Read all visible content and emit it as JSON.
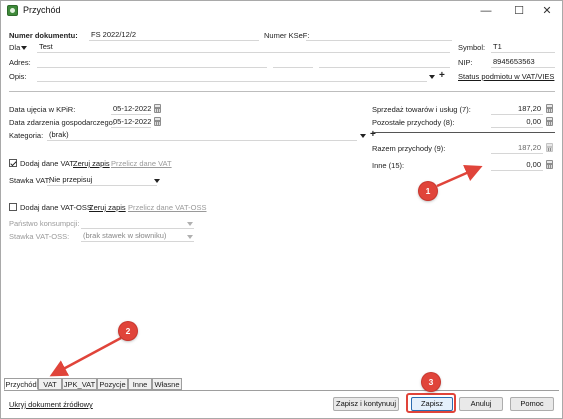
{
  "window": {
    "title": "Przychód",
    "controls": {
      "minimize": "—",
      "maximize": "☐",
      "close": "✕"
    }
  },
  "header": {
    "doc_number_label": "Numer dokumentu:",
    "doc_number_value": "FS 2022/12/2",
    "ksef_label": "Numer KSeF:",
    "ksef_value": "",
    "for_label": "Dla",
    "for_value": "Test",
    "symbol_label": "Symbol:",
    "symbol_value": "T1",
    "address_label": "Adres:",
    "address_value": "",
    "nip_label": "NIP:",
    "nip_value": "8945653563",
    "description_label": "Opis:",
    "description_value": "",
    "vat_status_link": "Status podmiotu w VAT/VIES"
  },
  "dates": {
    "kpir_label": "Data ujęcia w KPiR:",
    "kpir_value": "05-12-2022",
    "event_label": "Data zdarzenia gospodarczego:",
    "event_value": "05-12-2022",
    "category_label": "Kategoria:",
    "category_value": "(brak)"
  },
  "amounts": {
    "sales_label": "Sprzedaż towarów i usług (7):",
    "sales_value": "187,20",
    "other_income_label": "Pozostałe przychody (8):",
    "other_income_value": "0,00",
    "total_label": "Razem przychody (9):",
    "total_value": "187,20",
    "other_label": "Inne (15):",
    "other_value": "0,00"
  },
  "vat": {
    "add_vat_label": "Dodaj dane VAT",
    "add_vat_checked": true,
    "clear_link": "Zeruj zapis",
    "recalc_link": "Przelicz dane VAT",
    "rate_label": "Stawka VAT:",
    "rate_value": "Nie przepisuj"
  },
  "vat_oss": {
    "add_label": "Dodaj dane VAT-OSS",
    "add_checked": false,
    "clear_link": "Zeruj zapis",
    "recalc_link": "Przelicz dane VAT-OSS",
    "country_label": "Państwo konsumpcji:",
    "country_value": "",
    "rate_label": "Stawka VAT-OSS:",
    "rate_value": "(brak stawek w słowniku)"
  },
  "tabs": [
    "Przychód",
    "VAT",
    "JPK_VAT",
    "Pozycje",
    "Inne",
    "Własne"
  ],
  "footer": {
    "hide_source_link": "Ukryj dokument źródłowy",
    "save_continue": "Zapisz i kontynuuj",
    "save": "Zapisz",
    "cancel": "Anuluj",
    "help": "Pomoc"
  },
  "annotations": {
    "badge1": "1",
    "badge2": "2",
    "badge3": "3",
    "color": "#e0443a"
  }
}
